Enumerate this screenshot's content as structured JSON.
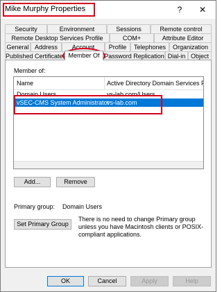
{
  "window": {
    "title": "Mike Murphy Properties",
    "help_glyph": "?",
    "close_glyph": "✕"
  },
  "tabs": {
    "row1": [
      "Security",
      "Environment",
      "Sessions",
      "Remote control"
    ],
    "row2": [
      "Remote Desktop Services Profile",
      "COM+",
      "Attribute Editor"
    ],
    "row3": [
      "General",
      "Address",
      "Account",
      "Profile",
      "Telephones",
      "Organization"
    ],
    "row4": [
      "Published Certificates",
      "Member Of",
      "Password Replication",
      "Dial-in",
      "Object"
    ],
    "active": "Member Of"
  },
  "member_of": {
    "label": "Member of:",
    "columns": [
      "Name",
      "Active Directory Domain Services Fol"
    ],
    "rows": [
      {
        "name": "Domain Users",
        "folder": "vs-lab.com/Users",
        "selected": false
      },
      {
        "name": "vSEC-CMS System Administrator",
        "folder": "vs-lab.com",
        "selected": true
      }
    ]
  },
  "buttons": {
    "add": "Add...",
    "remove": "Remove",
    "set_primary": "Set Primary Group",
    "ok": "OK",
    "cancel": "Cancel",
    "apply": "Apply",
    "help": "Help"
  },
  "primary_group": {
    "label": "Primary group:",
    "value": "Domain Users",
    "note": "There is no need to change Primary group unless you have Macintosh clients or POSIX-compliant applications."
  },
  "colors": {
    "annotation": "#d6001c",
    "selection": "#0078d7"
  }
}
